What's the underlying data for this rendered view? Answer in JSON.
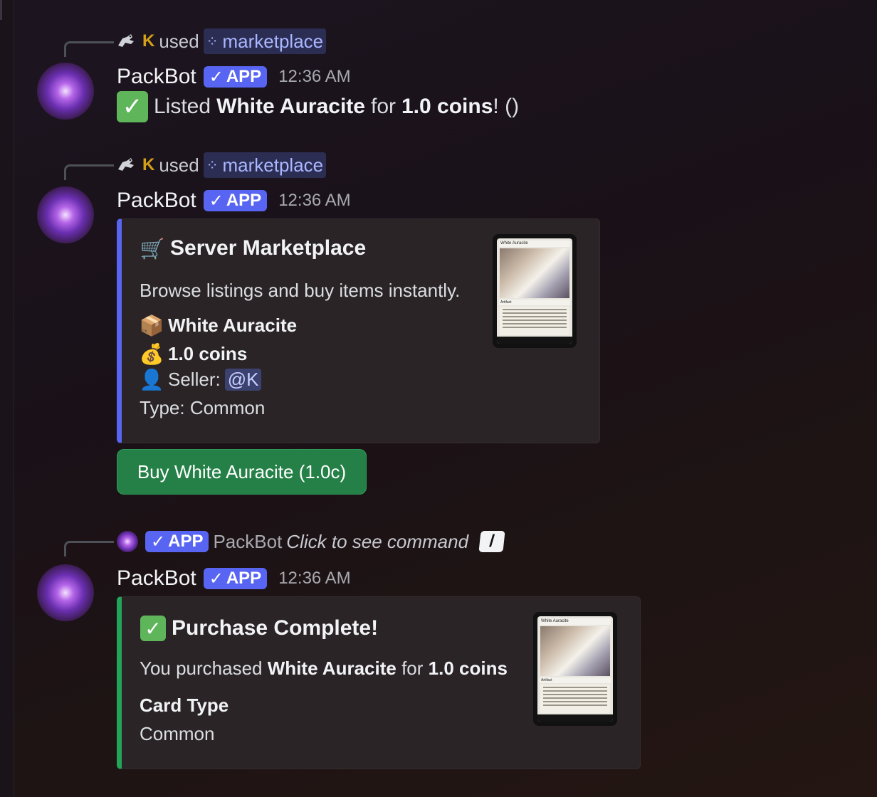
{
  "bot": {
    "name": "PackBot",
    "badge": "APP",
    "badge_icon": "✓"
  },
  "messages": [
    {
      "reply": {
        "user_initial": "K",
        "verb": "used",
        "command": "marketplace"
      },
      "timestamp": "12:36 AM",
      "text": {
        "prefix": "Listed",
        "item": "White Auracite",
        "mid": "for",
        "amount": "1.0 coins",
        "suffix": "! ()"
      }
    },
    {
      "reply": {
        "user_initial": "K",
        "verb": "used",
        "command": "marketplace"
      },
      "timestamp": "12:36 AM",
      "embed": {
        "title": "Server Marketplace",
        "description": "Browse listings and buy items instantly.",
        "item_name": "White Auracite",
        "price": "1.0 coins",
        "seller_label": "Seller:",
        "seller_mention": "@K",
        "type_line": "Type: Common",
        "card_name": "White Auracite",
        "card_type": "Artifact"
      },
      "button": {
        "label": "Buy White Auracite (1.0c)"
      }
    },
    {
      "reply": {
        "badge": "APP",
        "name": "PackBot",
        "hint": "Click to see command"
      },
      "timestamp": "12:36 AM",
      "embed": {
        "title": "Purchase Complete!",
        "desc_prefix": "You purchased",
        "item": "White Auracite",
        "desc_mid": "for",
        "amount": "1.0 coins",
        "field_name": "Card Type",
        "field_value": "Common",
        "card_name": "White Auracite",
        "card_type": "Artifact"
      }
    }
  ],
  "colors": {
    "blurple": "#5865f2",
    "success": "#23a559",
    "button": "#248046"
  }
}
